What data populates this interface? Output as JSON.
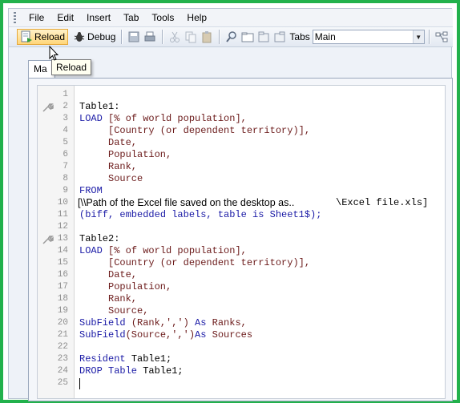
{
  "menu": [
    "File",
    "Edit",
    "Insert",
    "Tab",
    "Tools",
    "Help"
  ],
  "toolbar": {
    "reload_label": "Reload",
    "debug_label": "Debug",
    "tabs_label": "Tabs",
    "tab_select_value": "Main"
  },
  "tab": {
    "label": "Ma"
  },
  "tooltip": {
    "text": "Reload"
  },
  "editor": {
    "line_numbers": [
      "1",
      "2",
      "3",
      "4",
      "5",
      "6",
      "7",
      "8",
      "9",
      "10",
      "11",
      "12",
      "13",
      "14",
      "15",
      "16",
      "17",
      "18",
      "19",
      "20",
      "21",
      "22",
      "23",
      "24",
      "25"
    ],
    "lines": {
      "l2": "Table1:",
      "l3_kw": "LOAD",
      "l3_rest": "[% of world population],",
      "l4": "[Country (or dependent territory)],",
      "l5": "Date,",
      "l6": "Population,",
      "l7": "Rank,",
      "l8": "Source",
      "l9": "FROM",
      "l10_a": "[\\\\Path of the Excel file saved on the desktop as..",
      "l10_b": "\\Excel file.xls]",
      "l11": "(biff, embedded labels, table is Sheet1$);",
      "l13": "Table2:",
      "l14_kw": "LOAD",
      "l14_rest": "[% of world population],",
      "l15": "[Country (or dependent territory)],",
      "l16": "Date,",
      "l17": "Population,",
      "l18": "Rank,",
      "l19": "Source,",
      "l20_fn": "SubField",
      "l20_mid": "(Rank,',')",
      "l20_as": "As",
      "l20_name": "Ranks,",
      "l21_fn": "SubField",
      "l21_mid": "(Source,',')",
      "l21_as": "As",
      "l21_name": "Sources",
      "l23_kw": "Resident",
      "l23_rest": "Table1;",
      "l24_kw": "DROP Table",
      "l24_rest": "Table1;"
    }
  },
  "colors": {
    "frame_border": "#22b14c",
    "keyword": "#1a1aa6",
    "field": "#6b1a1a"
  }
}
